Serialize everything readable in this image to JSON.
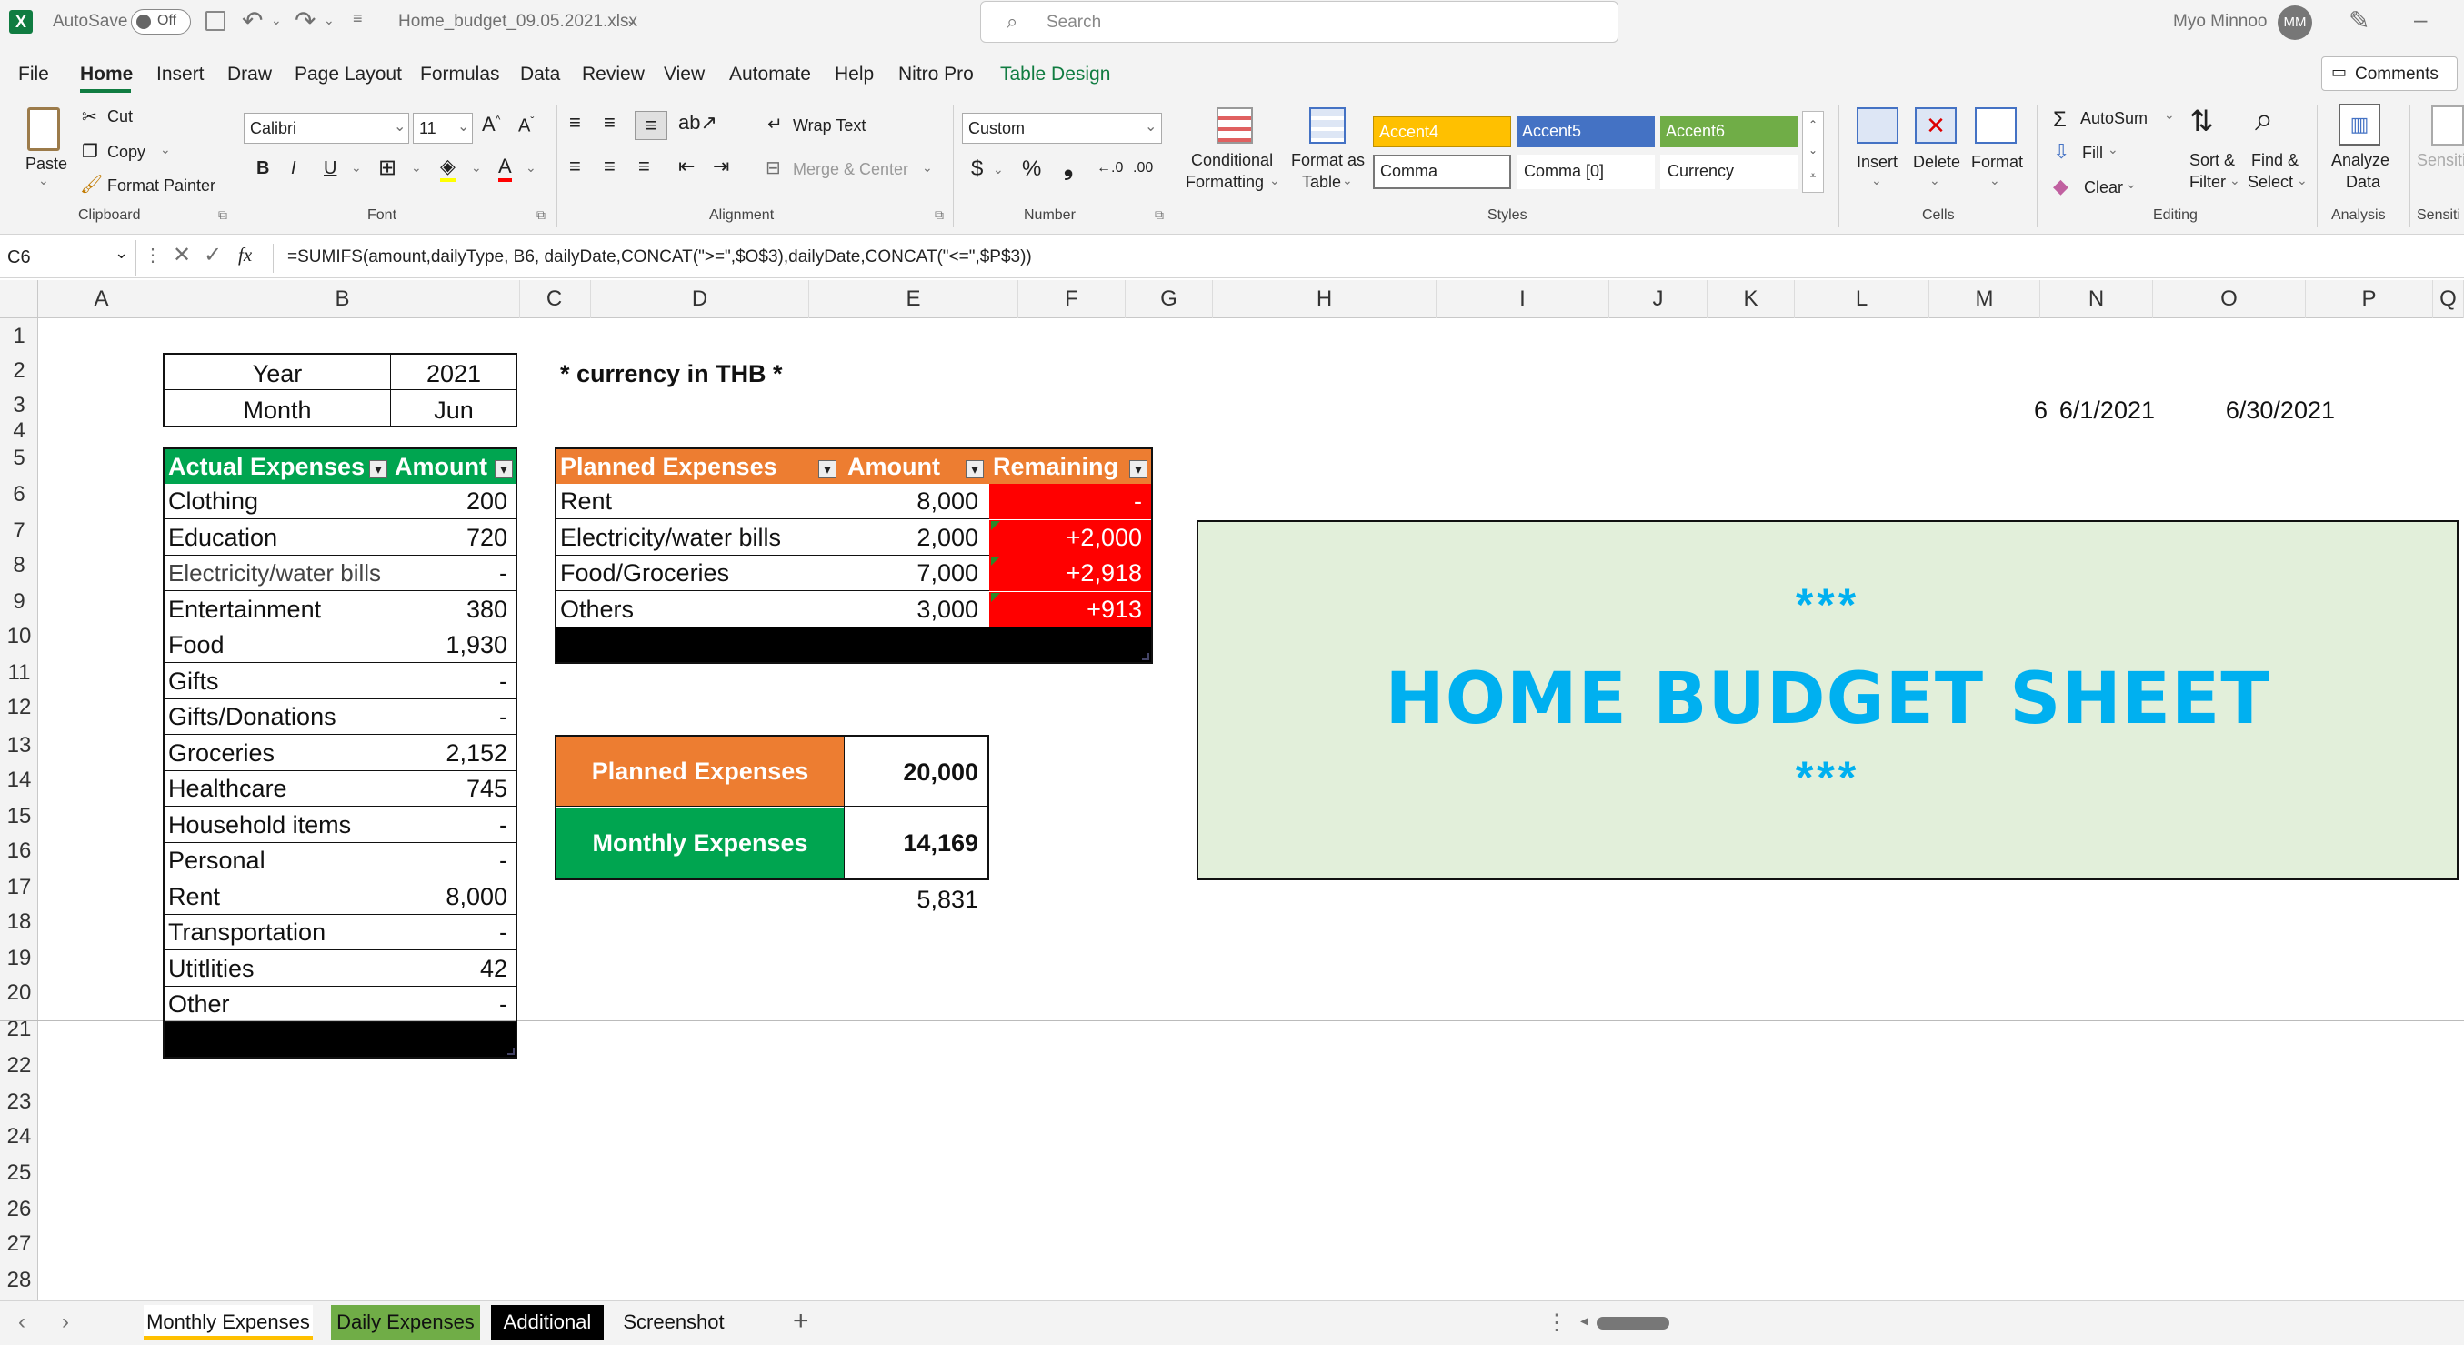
{
  "titlebar": {
    "autosave_label": "AutoSave",
    "autosave_state": "Off",
    "filename": "Home_budget_09.05.2021.xlsx",
    "search_placeholder": "Search",
    "user_name": "Myo Minnoo",
    "user_initials": "MM"
  },
  "tabs": [
    "File",
    "Home",
    "Insert",
    "Draw",
    "Page Layout",
    "Formulas",
    "Data",
    "Review",
    "View",
    "Automate",
    "Help",
    "Nitro Pro",
    "Table Design"
  ],
  "comments_label": "Comments",
  "clipboard": {
    "paste": "Paste",
    "cut": "Cut",
    "copy": "Copy",
    "format_painter": "Format Painter",
    "group": "Clipboard"
  },
  "font": {
    "name": "Calibri",
    "size": "11",
    "group": "Font"
  },
  "alignment": {
    "wrap": "Wrap Text",
    "merge": "Merge & Center",
    "group": "Alignment"
  },
  "number": {
    "format": "Custom",
    "group": "Number"
  },
  "styles": {
    "cond1": "Conditional",
    "cond2": "Formatting",
    "fmt1": "Format as",
    "fmt2": "Table",
    "accent4": "Accent4",
    "accent5": "Accent5",
    "accent6": "Accent6",
    "comma": "Comma",
    "comma0": "Comma [0]",
    "currency": "Currency",
    "group": "Styles"
  },
  "cells": {
    "insert": "Insert",
    "delete": "Delete",
    "format": "Format",
    "group": "Cells"
  },
  "editing": {
    "autosum": "AutoSum",
    "fill": "Fill",
    "clear": "Clear",
    "sort1": "Sort &",
    "sort2": "Filter",
    "find1": "Find &",
    "find2": "Select",
    "group": "Editing"
  },
  "analysis": {
    "analyze1": "Analyze",
    "analyze2": "Data",
    "group": "Analysis"
  },
  "sensitivity": {
    "label": "Sensiti",
    "group": "Sensiti"
  },
  "formula_bar": {
    "name_box": "C6",
    "fx": "fx",
    "formula": "=SUMIFS(amount,dailyType, B6, dailyDate,CONCAT(\">=\",$O$3),dailyDate,CONCAT(\"<=\",$P$3))"
  },
  "columns": [
    "A",
    "B",
    "C",
    "D",
    "E",
    "F",
    "G",
    "H",
    "I",
    "J",
    "K",
    "L",
    "M",
    "N",
    "O",
    "P",
    "Q"
  ],
  "rows": [
    "1",
    "2",
    "3",
    "4",
    "5",
    "6",
    "7",
    "8",
    "9",
    "10",
    "11",
    "12",
    "13",
    "14",
    "15",
    "16",
    "17",
    "18",
    "19",
    "20",
    "21",
    "22",
    "23",
    "24",
    "25",
    "26",
    "27",
    "28"
  ],
  "year_month": {
    "year_label": "Year",
    "year_value": "2021",
    "month_label": "Month",
    "month_value": "Jun"
  },
  "currency_note": "* currency in THB *",
  "helper": {
    "n3": "6",
    "o3": "6/1/2021",
    "p3": "6/30/2021"
  },
  "actual": {
    "header_category": "Actual Expenses",
    "header_amount": "Amount",
    "rows": [
      {
        "category": "Clothing",
        "amount": "200"
      },
      {
        "category": "Education",
        "amount": "720"
      },
      {
        "category": "Electricity/water bills",
        "amount": "-"
      },
      {
        "category": "Entertainment",
        "amount": "380"
      },
      {
        "category": "Food",
        "amount": "1,930"
      },
      {
        "category": "Gifts",
        "amount": "-"
      },
      {
        "category": "Gifts/Donations",
        "amount": "-"
      },
      {
        "category": "Groceries",
        "amount": "2,152"
      },
      {
        "category": "Healthcare",
        "amount": "745"
      },
      {
        "category": "Household items",
        "amount": "-"
      },
      {
        "category": "Personal",
        "amount": "-"
      },
      {
        "category": "Rent",
        "amount": "8,000"
      },
      {
        "category": "Transportation",
        "amount": "-"
      },
      {
        "category": "Utitlities",
        "amount": "42"
      },
      {
        "category": "Other",
        "amount": "-"
      }
    ]
  },
  "planned": {
    "header_category": "Planned Expenses",
    "header_amount": "Amount",
    "header_remaining": "Remaining",
    "rows": [
      {
        "category": "Rent",
        "amount": "8,000",
        "remaining": "-"
      },
      {
        "category": "Electricity/water bills",
        "amount": "2,000",
        "remaining": "+2,000"
      },
      {
        "category": "Food/Groceries",
        "amount": "7,000",
        "remaining": "+2,918"
      },
      {
        "category": "Others",
        "amount": "3,000",
        "remaining": "+913"
      }
    ]
  },
  "summary": {
    "planned_label": "Planned Expenses",
    "planned_value": "20,000",
    "monthly_label": "Monthly Expenses",
    "monthly_value": "14,169",
    "difference": "5,831"
  },
  "banner": {
    "stars_top": "***",
    "title": "HOME BUDGET SHEET",
    "stars_bottom": "***"
  },
  "sheets": [
    "Monthly Expenses",
    "Daily Expenses",
    "Additional",
    "Screenshot"
  ],
  "add_sheet": "+",
  "colors": {
    "green": "#00a550",
    "orange": "#ed7d31",
    "red": "#ff0000",
    "banner_bg": "#e2efda",
    "banner_text": "#00b0f0",
    "accent4": "#ffc000",
    "accent5": "#4472c4",
    "accent6": "#70ad47"
  }
}
